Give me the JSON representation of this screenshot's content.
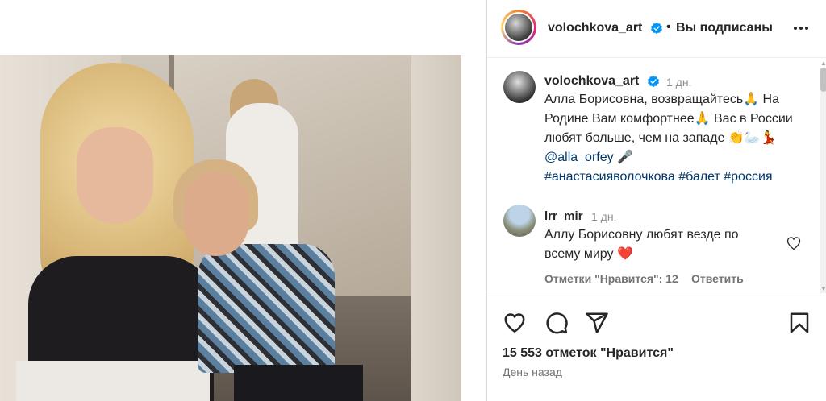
{
  "post": {
    "username": "volochkova_art",
    "follow_state": "Вы подписаны",
    "caption": {
      "username": "volochkova_art",
      "time": "1 дн.",
      "text_part1": "Алла Борисовна, возвращайтесь🙏 На Родине Вам комфортнее🙏 Вас в России любят больше, чем на западе 👏🦢💃 ",
      "mention": "@alla_orfey",
      "text_part2": " 🎤",
      "hashtags": "#анастасияволочкова #балет #россия"
    },
    "comment": {
      "username": "lrr_mir",
      "time": "1 дн.",
      "text": "Аллу Борисовну любят везде по всему миру ❤️",
      "likes_label": "Отметки \"Нравится\": 12",
      "reply_label": "Ответить"
    },
    "likes": "15 553 отметок \"Нравится\"",
    "date": "День назад"
  },
  "icons": {
    "verified": "verified-badge-icon",
    "more": "more-options-icon",
    "like": "heart-icon",
    "comment": "comment-icon",
    "share": "share-icon",
    "save": "bookmark-icon"
  },
  "colors": {
    "verified": "#0095f6",
    "link": "#00376b",
    "heart_red": "#ed4956",
    "muted": "#737373"
  }
}
